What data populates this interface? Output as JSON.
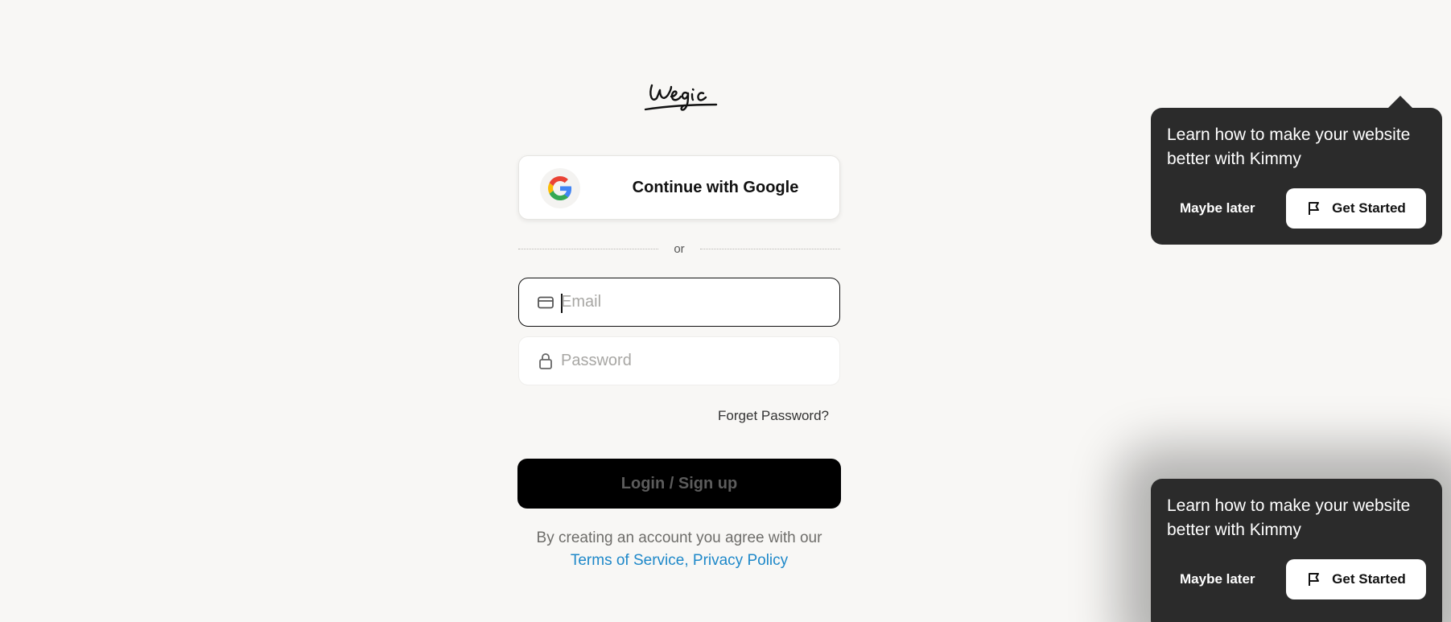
{
  "brand": {
    "logo_text": "wegic"
  },
  "auth": {
    "google_button_label": "Continue with Google",
    "divider_text": "or",
    "email": {
      "placeholder": "Email",
      "value": ""
    },
    "password": {
      "placeholder": "Password",
      "value": ""
    },
    "forgot_password_label": "Forget Password?",
    "login_button_label": "Login / Sign up",
    "terms": {
      "prefix": "By creating an account you agree with our",
      "terms_link": "Terms of Service",
      "separator": ",",
      "privacy_link": "Privacy Policy"
    }
  },
  "tour_popups": [
    {
      "message": "Learn how to make your website better with Kimmy",
      "maybe_later_label": "Maybe later",
      "get_started_label": "Get Started"
    },
    {
      "message": "Learn how to make your website better with Kimmy",
      "maybe_later_label": "Maybe later",
      "get_started_label": "Get Started"
    }
  ],
  "colors": {
    "background": "#f8f7f5",
    "link": "#1e88c9",
    "popup": "#2b2b2b",
    "login_button": "#000000"
  },
  "icons": {
    "google": "google-g-icon",
    "email": "mail-icon",
    "password": "lock-icon",
    "get_started": "flag-icon"
  }
}
